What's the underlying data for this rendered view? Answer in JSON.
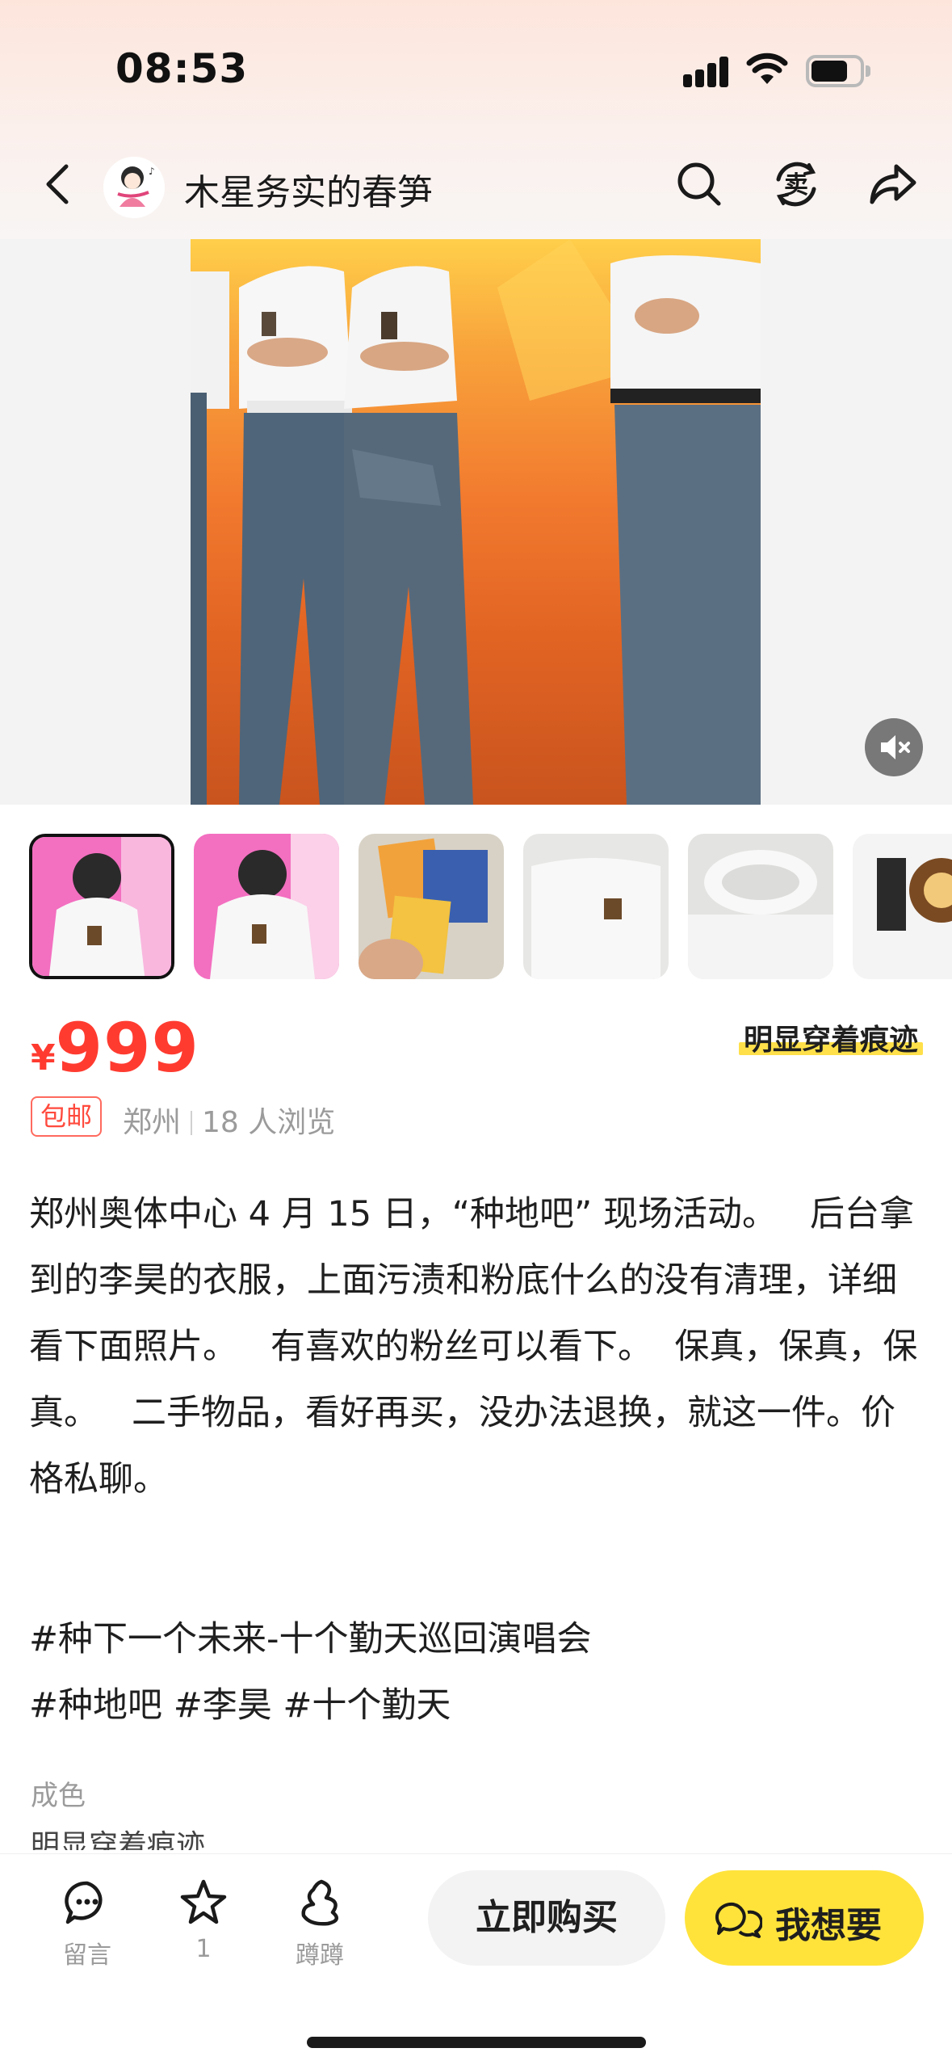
{
  "status_bar": {
    "time": "08:53"
  },
  "header": {
    "seller_name": "木星务实的春笋",
    "icons": [
      "back-icon",
      "search-icon",
      "sell-icon",
      "share-icon"
    ]
  },
  "media": {
    "thumbnail_count": 6,
    "active_thumbnail": 0,
    "mute_icon": "mute-icon"
  },
  "product": {
    "currency": "¥",
    "price": "999",
    "condition_tag": "明显穿着痕迹",
    "shipping_badge": "包邮",
    "location": "郑州",
    "views": "18 人浏览"
  },
  "description": {
    "text": "郑州奥体中心 4 月 15 日，“种地吧” 现场活动。   后台拿到的李昊的衣服，上面污渍和粉底什么的没有清理，详细看下面照片。   有喜欢的粉丝可以看下。  保真，保真，保真。   二手物品，看好再买，没办法退换，就这一件。价格私聊。",
    "tag_line_1": "#种下一个未来-十个勤天巡回演唱会",
    "tag_line_2": "#种地吧  #李昊  #十个勤天",
    "condition_label": "成色",
    "condition_value": "明显穿着痕迹"
  },
  "bottom_bar": {
    "comment_label": "留言",
    "favorite_count": "1",
    "nudge_label": "蹲蹲",
    "buy_now": "立即购买",
    "want": "我想要"
  },
  "colors": {
    "price_red": "#ff3b30",
    "accent_yellow": "#ffe33b",
    "muted_text": "#9b9b9b"
  }
}
